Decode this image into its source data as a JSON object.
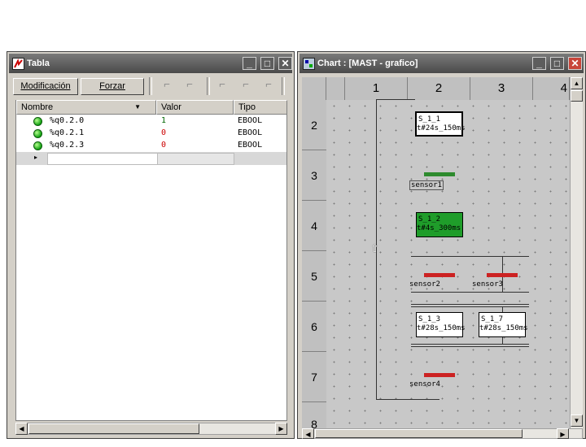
{
  "left_window": {
    "title": "Tabla",
    "toolbar": {
      "modify_label": "Modificación",
      "force_label": "Forzar"
    },
    "columns": [
      "Nombre",
      "Valor",
      "Tipo"
    ],
    "rows": [
      {
        "name": "%q0.2.0",
        "value": "1",
        "type": "EBOOL"
      },
      {
        "name": "%q0.2.1",
        "value": "0",
        "type": "EBOOL"
      },
      {
        "name": "%q0.2.3",
        "value": "0",
        "type": "EBOOL"
      }
    ]
  },
  "right_window": {
    "title": "Chart : [MAST - grafico]",
    "col_headers": [
      "1",
      "2",
      "3",
      "4"
    ],
    "row_headers": [
      "2",
      "3",
      "4",
      "5",
      "6",
      "7",
      "8"
    ],
    "steps": {
      "s1": {
        "name": "S_1_1",
        "time": "t#24s_150ms"
      },
      "s2": {
        "name": "S_1_2",
        "time": "t#4s_300ms"
      },
      "s3": {
        "name": "S_1_3",
        "time": "t#28s_150ms"
      },
      "s7": {
        "name": "S_1_7",
        "time": "t#28s_150ms"
      }
    },
    "transitions": {
      "t1": "sensor1",
      "t2": "sensor2",
      "t3": "sensor3",
      "t4": "sensor4"
    },
    "colors": {
      "active_step": "#1f9d2a",
      "transition_true": "#2e8b2e",
      "transition_false": "#cc2222"
    }
  }
}
